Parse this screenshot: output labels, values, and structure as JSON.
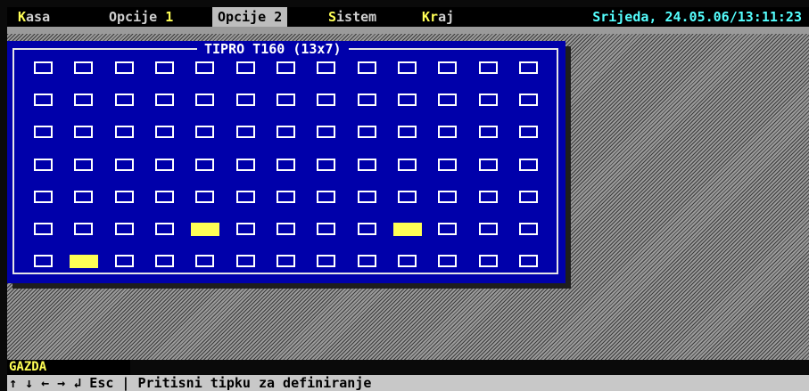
{
  "menu": {
    "items": [
      {
        "hot": "K",
        "rest": "asa"
      },
      {
        "hot": "",
        "rest": "Opcije ",
        "suffix": "1"
      },
      {
        "hot": "",
        "rest": "Opcije 2",
        "suffix": ""
      },
      {
        "hot": "S",
        "rest": "istem"
      },
      {
        "hot": "Kr",
        "rest": "aj"
      }
    ],
    "selected_index": 2,
    "datetime": "Srijeda, 24.05.06/13:11:23"
  },
  "dialog": {
    "title": "TIPRO T160 (13x7)",
    "rows": 7,
    "cols": 13,
    "defined_keys": [
      {
        "row": 6,
        "col": 5
      },
      {
        "row": 6,
        "col": 10
      },
      {
        "row": 7,
        "col": 2
      }
    ]
  },
  "status": {
    "user": "GAZDA",
    "hint": "↑ ↓ ← → ↲ Esc | Pritisni tipku za definiranje"
  },
  "colors": {
    "window_bg": "#0000aa",
    "defined_key": "#ffff55",
    "clock": "#55ffff",
    "hotkey": "#ffff55"
  }
}
